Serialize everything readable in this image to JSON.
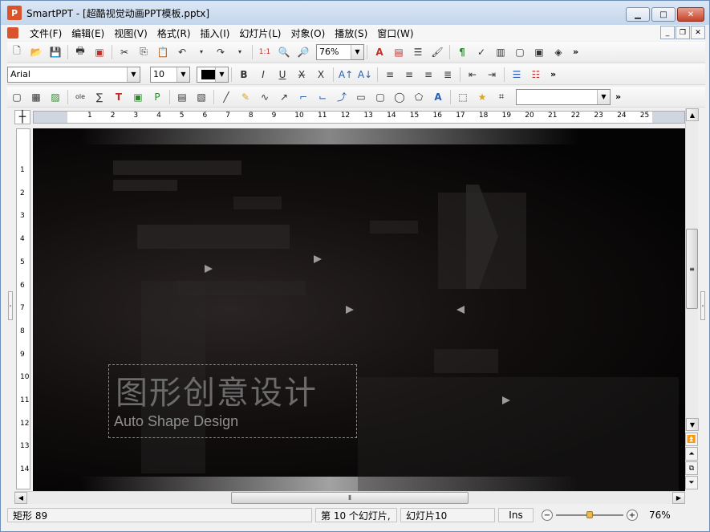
{
  "window": {
    "app_name": "SmartPPT",
    "title": "SmartPPT - [超酷视觉动画PPT模板.pptx]"
  },
  "menu": {
    "items": [
      "文件(F)",
      "编辑(E)",
      "视图(V)",
      "格式(R)",
      "插入(I)",
      "幻灯片(L)",
      "对象(O)",
      "播放(S)",
      "窗口(W)"
    ]
  },
  "toolbar1": {
    "zoom_value": "76%"
  },
  "toolbar2": {
    "font_name": "Arial",
    "font_size": "10",
    "font_color": "#000000"
  },
  "toolbar3": {
    "style_value": ""
  },
  "ruler": {
    "h_ticks": [
      "1",
      "2",
      "3",
      "4",
      "5",
      "6",
      "7",
      "8",
      "9",
      "10",
      "11",
      "12",
      "13",
      "14",
      "15",
      "16",
      "17",
      "18",
      "19",
      "20",
      "21",
      "22",
      "23",
      "24",
      "25"
    ],
    "v_ticks": [
      "1",
      "2",
      "3",
      "4",
      "5",
      "6",
      "7",
      "8",
      "9",
      "10",
      "11",
      "12",
      "13",
      "14"
    ]
  },
  "slide": {
    "title": "图形创意设计",
    "subtitle": "Auto Shape Design"
  },
  "status": {
    "object": "矩形 89",
    "slide_position": "第 10 个幻灯片,",
    "slide_name": "幻灯片10",
    "mode": "Ins",
    "zoom": "76%",
    "zoom_level": 0.5
  }
}
